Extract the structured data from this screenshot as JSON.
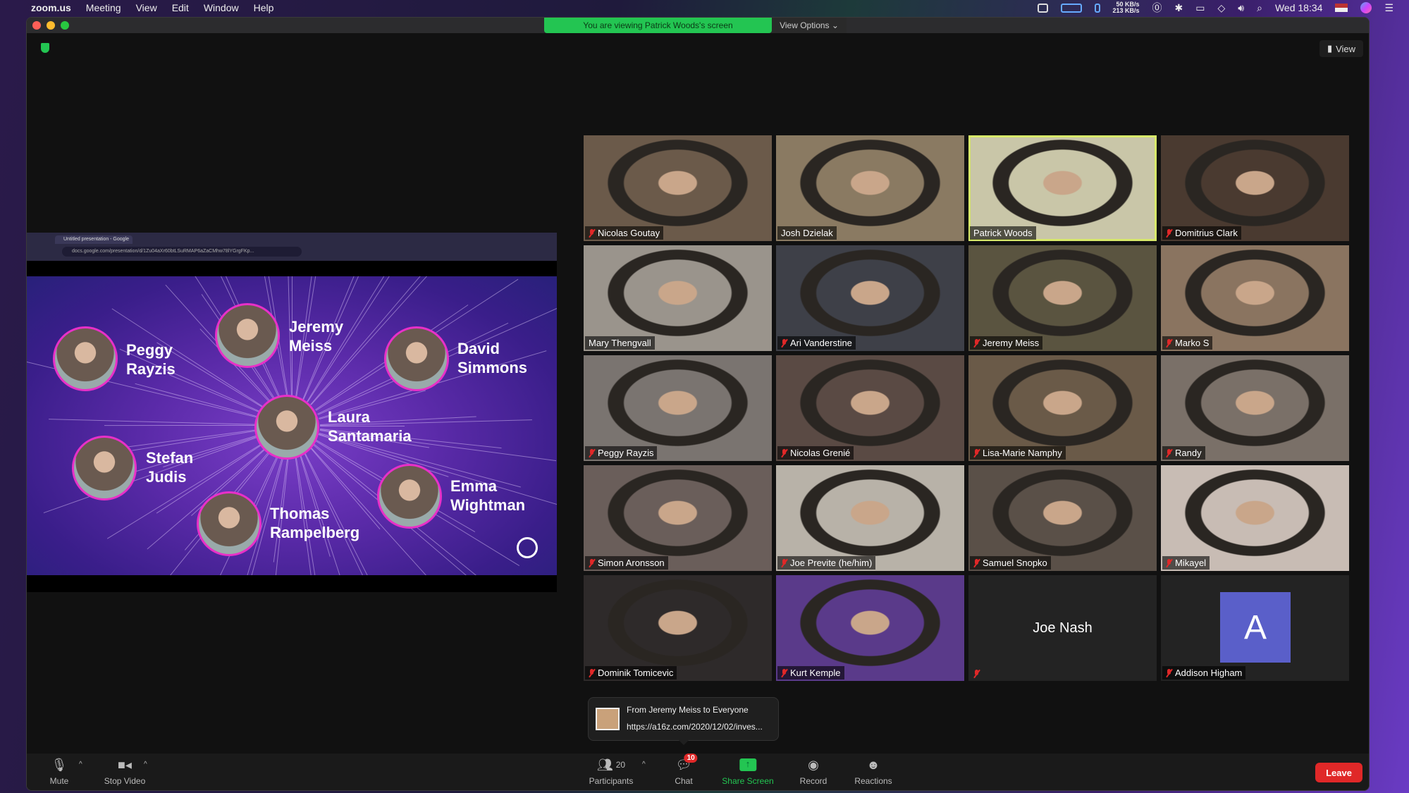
{
  "menubar": {
    "app_name": "zoom.us",
    "menus": [
      "Meeting",
      "View",
      "Edit",
      "Window",
      "Help"
    ],
    "net_up": "50 KB/s",
    "net_down": "213 KB/s",
    "clock": "Wed 18:34"
  },
  "window": {
    "banner": "You are viewing Patrick Woods's screen",
    "view_options": "View Options ⌄",
    "view_button": "View"
  },
  "shared_screen": {
    "tab_title": "Untitled presentation - Google",
    "url": "docs.google.com/presentation/d/1Zu04aXr60btLSuRMAP6aZaCMhw78lYGrgFKp...",
    "speakers": [
      {
        "first": "Peggy",
        "last": "Rayzis"
      },
      {
        "first": "Jeremy",
        "last": "Meiss"
      },
      {
        "first": "David",
        "last": "Simmons"
      },
      {
        "first": "Laura",
        "last": "Santamaria"
      },
      {
        "first": "Stefan",
        "last": "Judis"
      },
      {
        "first": "Thomas",
        "last": "Rampelberg"
      },
      {
        "first": "Emma",
        "last": "Wightman"
      }
    ]
  },
  "participants": [
    {
      "name": "Nicolas Goutay",
      "muted": true
    },
    {
      "name": "Josh Dzielak",
      "muted": false
    },
    {
      "name": "Patrick Woods",
      "muted": false,
      "active_speaker": true
    },
    {
      "name": "Domitrius Clark",
      "muted": true
    },
    {
      "name": "Mary Thengvall",
      "muted": false
    },
    {
      "name": "Ari Vanderstine",
      "muted": true
    },
    {
      "name": "Jeremy Meiss",
      "muted": true
    },
    {
      "name": "Marko S",
      "muted": true
    },
    {
      "name": "Peggy Rayzis",
      "muted": true
    },
    {
      "name": "Nicolas Grenié",
      "muted": true
    },
    {
      "name": "Lisa-Marie Namphy",
      "muted": true
    },
    {
      "name": "Randy",
      "muted": true
    },
    {
      "name": "Simon Aronsson",
      "muted": true
    },
    {
      "name": "Joe Previte (he/him)",
      "muted": true
    },
    {
      "name": "Samuel Snopko",
      "muted": true
    },
    {
      "name": "Mikayel",
      "muted": true
    },
    {
      "name": "Dominik Tomicevic",
      "muted": true
    },
    {
      "name": "Kurt Kemple",
      "muted": true
    },
    {
      "name": "Joe Nash",
      "muted": true,
      "video_off": true
    },
    {
      "name": "Addison Higham",
      "muted": true,
      "video_off": true,
      "avatar_letter": "A"
    }
  ],
  "chat_notification": {
    "from": "From Jeremy Meiss to Everyone",
    "message": "https://a16z.com/2020/12/02/inves..."
  },
  "toolbar": {
    "mute": "Mute",
    "stop_video": "Stop Video",
    "participants": "Participants",
    "participant_count": "20",
    "chat": "Chat",
    "chat_badge": "10",
    "share_screen": "Share Screen",
    "record": "Record",
    "reactions": "Reactions",
    "leave": "Leave"
  },
  "colors": {
    "active_speaker": "#d7e86a",
    "share_green": "#23c552",
    "leave_red": "#e02828",
    "muted_red": "#e02828",
    "avatar_bg": "#5a5fc9"
  }
}
